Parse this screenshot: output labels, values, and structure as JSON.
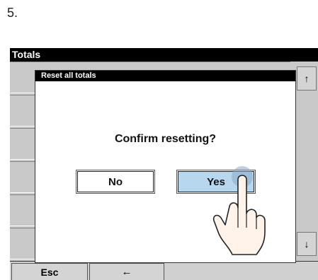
{
  "step_number": "5.",
  "window": {
    "title": "Totals"
  },
  "dialog": {
    "title": "Reset all totals",
    "question": "Confirm resetting?",
    "no_label": "No",
    "yes_label": "Yes"
  },
  "bottombar": {
    "esc_label": "Esc",
    "back_label": "←"
  },
  "scrollbar": {
    "up_label": "↑",
    "down_label": "↓"
  },
  "colors": {
    "yes_highlight": "#b7d7ef",
    "titlebar": "#000000",
    "screen_bg": "#c9c9c9",
    "touch_indicator": "#8aa8c8"
  },
  "icons": {
    "hand": "pointing-hand-icon"
  }
}
